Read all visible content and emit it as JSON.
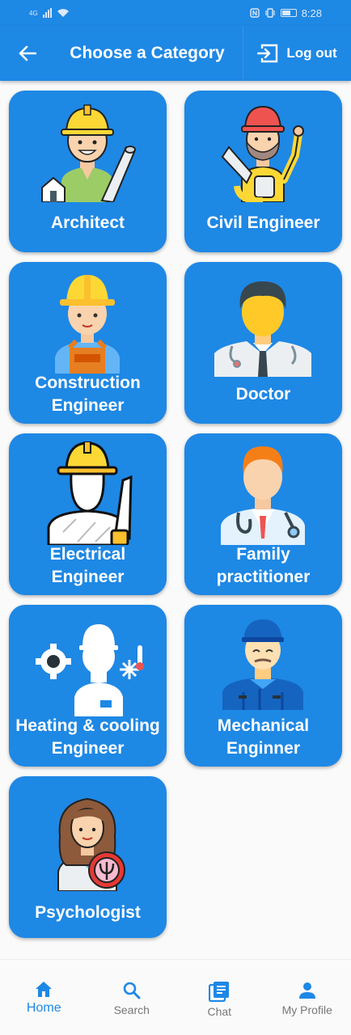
{
  "status_bar": {
    "time": "8:28",
    "network": "4G"
  },
  "app_bar": {
    "title": "Choose a Category",
    "logout_label": "Log out"
  },
  "categories": [
    {
      "label": "Architect",
      "icon": "architect-icon"
    },
    {
      "label": "Civil Engineer",
      "icon": "civil-engineer-icon"
    },
    {
      "label": "Construction Engineer",
      "icon": "construction-engineer-icon"
    },
    {
      "label": "Doctor",
      "icon": "doctor-icon"
    },
    {
      "label": "Electrical Engineer",
      "icon": "electrical-engineer-icon"
    },
    {
      "label": "Family practitioner",
      "icon": "family-practitioner-icon"
    },
    {
      "label": "Heating & cooling Engineer",
      "icon": "heating-cooling-engineer-icon"
    },
    {
      "label": "Mechanical Enginner",
      "icon": "mechanical-engineer-icon"
    },
    {
      "label": "Psychologist",
      "icon": "psychologist-icon"
    }
  ],
  "bottom_nav": [
    {
      "label": "Home",
      "icon": "home-icon",
      "active": true
    },
    {
      "label": "Search",
      "icon": "search-icon",
      "active": false
    },
    {
      "label": "Chat",
      "icon": "chat-icon",
      "active": false
    },
    {
      "label": "My Profile",
      "icon": "person-icon",
      "active": false
    }
  ],
  "colors": {
    "primary": "#1e88e5",
    "background": "#fafafa",
    "inactive": "#777777"
  }
}
